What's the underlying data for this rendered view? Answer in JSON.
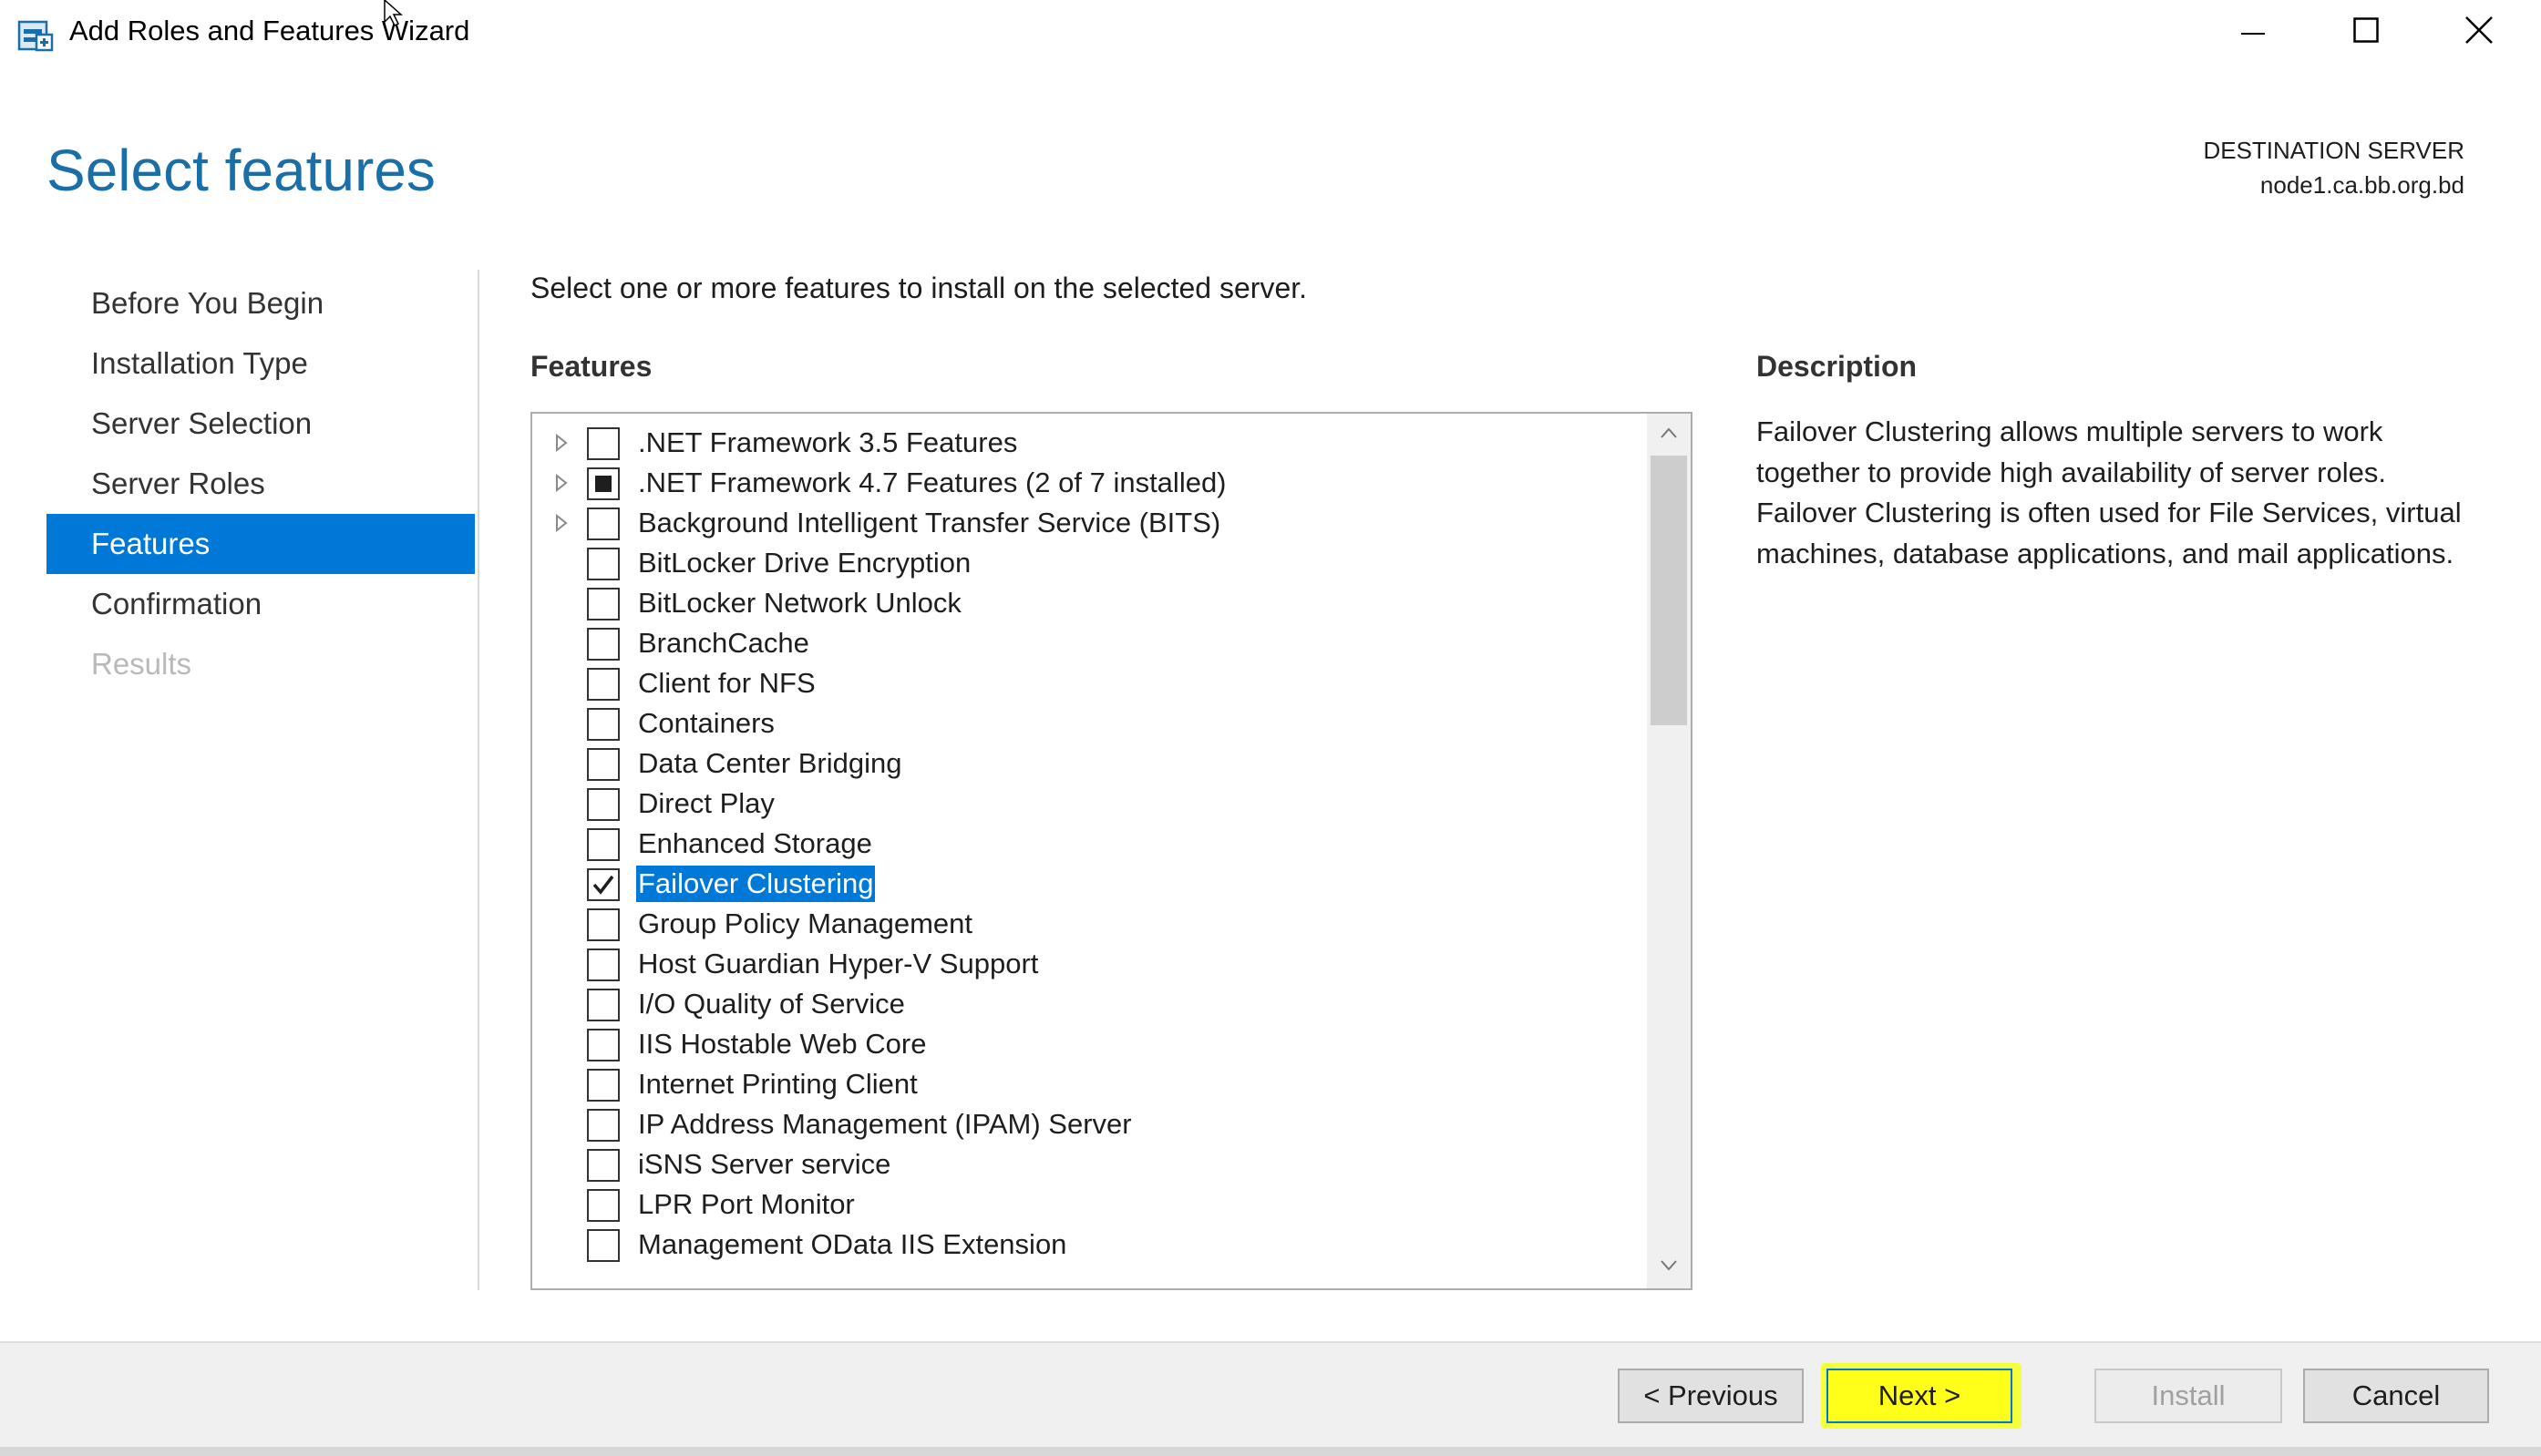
{
  "window": {
    "title": "Add Roles and Features Wizard",
    "controls": [
      "minimize-icon",
      "maximize-icon",
      "close-icon"
    ]
  },
  "header": {
    "title": "Select features",
    "destination_label": "DESTINATION SERVER",
    "destination_value": "node1.ca.bb.org.bd"
  },
  "nav": {
    "items": [
      {
        "label": "Before You Begin",
        "state": "normal"
      },
      {
        "label": "Installation Type",
        "state": "normal"
      },
      {
        "label": "Server Selection",
        "state": "normal"
      },
      {
        "label": "Server Roles",
        "state": "normal"
      },
      {
        "label": "Features",
        "state": "active"
      },
      {
        "label": "Confirmation",
        "state": "normal"
      },
      {
        "label": "Results",
        "state": "disabled"
      }
    ]
  },
  "main": {
    "instruction": "Select one or more features to install on the selected server.",
    "features_heading": "Features",
    "features": [
      {
        "label": ".NET Framework 3.5 Features",
        "expandable": true,
        "state": "unchecked"
      },
      {
        "label": ".NET Framework 4.7 Features (2 of 7 installed)",
        "expandable": true,
        "state": "partial"
      },
      {
        "label": "Background Intelligent Transfer Service (BITS)",
        "expandable": true,
        "state": "unchecked"
      },
      {
        "label": "BitLocker Drive Encryption",
        "expandable": false,
        "state": "unchecked"
      },
      {
        "label": "BitLocker Network Unlock",
        "expandable": false,
        "state": "unchecked"
      },
      {
        "label": "BranchCache",
        "expandable": false,
        "state": "unchecked"
      },
      {
        "label": "Client for NFS",
        "expandable": false,
        "state": "unchecked"
      },
      {
        "label": "Containers",
        "expandable": false,
        "state": "unchecked"
      },
      {
        "label": "Data Center Bridging",
        "expandable": false,
        "state": "unchecked"
      },
      {
        "label": "Direct Play",
        "expandable": false,
        "state": "unchecked"
      },
      {
        "label": "Enhanced Storage",
        "expandable": false,
        "state": "unchecked"
      },
      {
        "label": "Failover Clustering",
        "expandable": false,
        "state": "checked",
        "selected": true
      },
      {
        "label": "Group Policy Management",
        "expandable": false,
        "state": "unchecked"
      },
      {
        "label": "Host Guardian Hyper-V Support",
        "expandable": false,
        "state": "unchecked"
      },
      {
        "label": "I/O Quality of Service",
        "expandable": false,
        "state": "unchecked"
      },
      {
        "label": "IIS Hostable Web Core",
        "expandable": false,
        "state": "unchecked"
      },
      {
        "label": "Internet Printing Client",
        "expandable": false,
        "state": "unchecked"
      },
      {
        "label": "IP Address Management (IPAM) Server",
        "expandable": false,
        "state": "unchecked"
      },
      {
        "label": "iSNS Server service",
        "expandable": false,
        "state": "unchecked"
      },
      {
        "label": "LPR Port Monitor",
        "expandable": false,
        "state": "unchecked"
      },
      {
        "label": "Management OData IIS Extension",
        "expandable": false,
        "state": "unchecked"
      }
    ],
    "description_heading": "Description",
    "description_text": "Failover Clustering allows multiple servers to work together to provide high availability of server roles. Failover Clustering is often used for File Services, virtual machines, database applications, and mail applications."
  },
  "footer": {
    "previous": "< Previous",
    "next": "Next >",
    "install": "Install",
    "cancel": "Cancel"
  },
  "colors": {
    "accent": "#0078d7",
    "title_blue": "#1a6fa8",
    "highlight": "#ffff1a"
  }
}
